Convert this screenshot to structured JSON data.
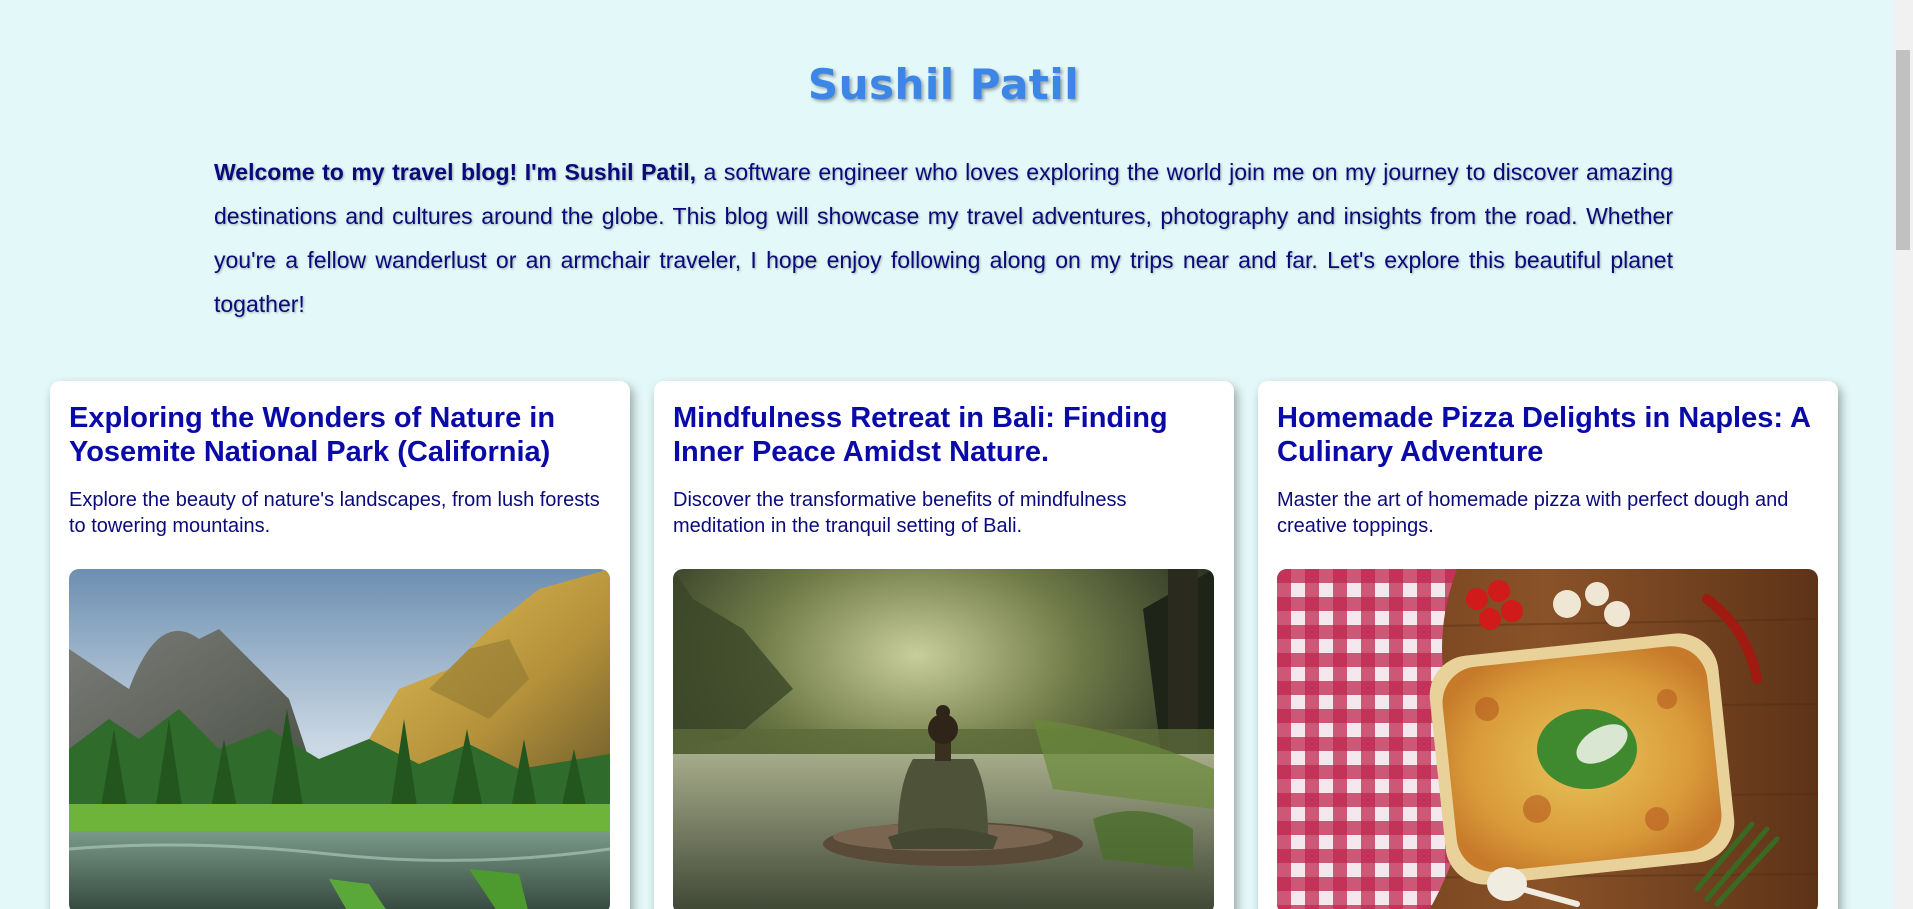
{
  "header": {
    "title": "Sushil Patil"
  },
  "intro": {
    "bold_text": "Welcome to my travel blog! I'm Sushil Patil,",
    "text": " a software engineer who loves exploring the world join me on my journey to discover amazing destinations and cultures around the globe. This blog will showcase my travel adventures, photography and insights from the road. Whether you're a fellow wanderlust or an armchair traveler, I hope enjoy following along on my trips near and far. Let's explore this beautiful planet togather!"
  },
  "cards": [
    {
      "title": "Exploring the Wonders of Nature in Yosemite National Park (California)",
      "description": "Explore the beauty of nature's landscapes, from lush forests to towering mountains.",
      "image": "yosemite-valley-photo"
    },
    {
      "title": "Mindfulness Retreat in Bali: Finding Inner Peace Amidst Nature.",
      "description": "Discover the transformative benefits of mindfulness meditation in the tranquil setting of Bali.",
      "image": "meditation-lake-photo"
    },
    {
      "title": "Homemade Pizza Delights in Naples: A Culinary Adventure",
      "description": "Master the art of homemade pizza with perfect dough and creative toppings.",
      "image": "pizza-table-photo"
    }
  ],
  "colors": {
    "background": "#e3f8f8",
    "title": "#3b86e6",
    "text": "#0a0a7a",
    "card_title": "#0a0aa8"
  }
}
